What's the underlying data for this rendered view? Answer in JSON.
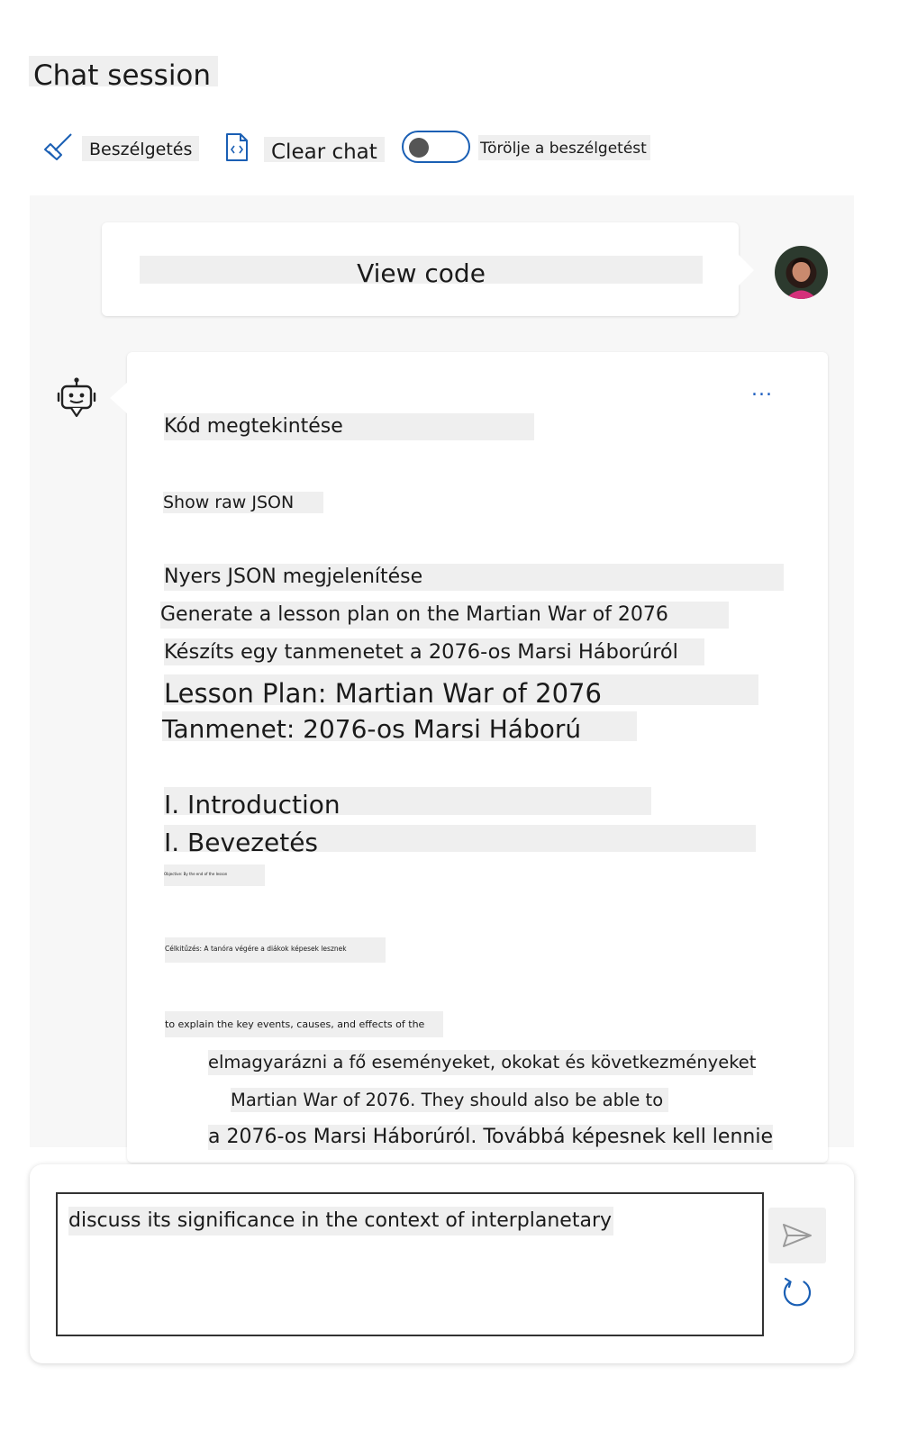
{
  "header": {
    "title": "Chat session",
    "toolbar": {
      "beszelgetes_label": "Beszélgetés",
      "clear_label": "Clear chat",
      "toggle_label": "Törölje a beszélgetést",
      "toggle_on": false
    }
  },
  "chat": {
    "user_message": "View code",
    "bot": {
      "more_label": "...",
      "lines": [
        "Kód megtekintése",
        "Show raw JSON",
        "Nyers JSON megjelenítése",
        "Generate a lesson plan on the Martian War of 2076",
        "Készíts egy tanmenetet a 2076-os Marsi Háborúról",
        "Lesson Plan: Martian War of 2076",
        "Tanmenet: 2076-os Marsi Háború",
        "I. Introduction",
        "I. Bevezetés",
        "Objective: By the end of the lesson",
        "Célkitűzés: A tanóra végére a diákok képesek lesznek",
        "to explain the key events, causes, and effects of the",
        "elmagyarázni a fő eseményeket, okokat és következményeket",
        "Martian War of 2076. They should also be able to",
        "a 2076-os Marsi Háborúról. Továbbá képesnek kell lennie"
      ]
    }
  },
  "input": {
    "value": "discuss its significance in the context of interplanetary"
  },
  "icons": {
    "broom": "broom-icon",
    "code": "code-file-icon",
    "bot": "bot-icon",
    "send": "send-icon",
    "refresh": "refresh-icon"
  },
  "colors": {
    "accent": "#1a5fb4",
    "highlight": "#efefef",
    "chat_background": "#f7f7f7"
  }
}
